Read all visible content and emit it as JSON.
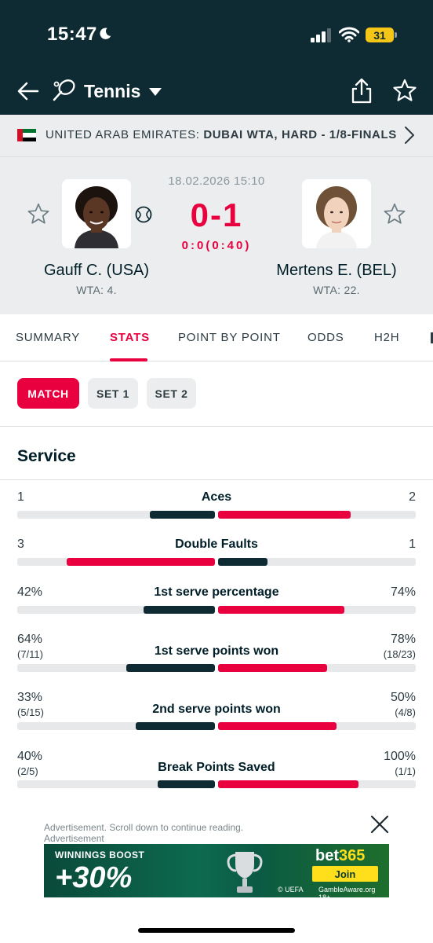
{
  "status_bar": {
    "time": "15:47",
    "battery": "31"
  },
  "header": {
    "sport": "Tennis"
  },
  "breadcrumb": {
    "country": "UNITED ARAB EMIRATES:",
    "tournament": "DUBAI WTA, HARD - 1/8-FINALS"
  },
  "match": {
    "datetime": "18.02.2026 15:10",
    "score": "0-1",
    "game_score": "0:0(0:40)",
    "home": {
      "name": "Gauff C. (USA)",
      "rank": "WTA: 4."
    },
    "away": {
      "name": "Mertens E. (BEL)",
      "rank": "WTA: 22."
    }
  },
  "tabs": [
    {
      "label": "SUMMARY"
    },
    {
      "label": "STATS"
    },
    {
      "label": "POINT BY POINT"
    },
    {
      "label": "ODDS"
    },
    {
      "label": "H2H"
    }
  ],
  "periods": [
    {
      "label": "MATCH"
    },
    {
      "label": "SET 1"
    },
    {
      "label": "SET 2"
    }
  ],
  "section": {
    "title": "Service"
  },
  "stats": [
    {
      "name": "Aces",
      "home": "1",
      "away": "2",
      "home_sub": "",
      "away_sub": "",
      "home_share": 0.33,
      "away_share": 0.67
    },
    {
      "name": "Double Faults",
      "home": "3",
      "away": "1",
      "home_sub": "",
      "away_sub": "",
      "home_share": 0.75,
      "away_share": 0.25
    },
    {
      "name": "1st serve percentage",
      "home": "42%",
      "away": "74%",
      "home_sub": "",
      "away_sub": "",
      "home_share": 0.36,
      "away_share": 0.64
    },
    {
      "name": "1st serve points won",
      "home": "64%",
      "away": "78%",
      "home_sub": "(7/11)",
      "away_sub": "(18/23)",
      "home_share": 0.45,
      "away_share": 0.55
    },
    {
      "name": "2nd serve points won",
      "home": "33%",
      "away": "50%",
      "home_sub": "(5/15)",
      "away_sub": "(4/8)",
      "home_share": 0.4,
      "away_share": 0.6
    },
    {
      "name": "Break Points Saved",
      "home": "40%",
      "away": "100%",
      "home_sub": "(2/5)",
      "away_sub": "(1/1)",
      "home_share": 0.29,
      "away_share": 0.71
    }
  ],
  "ad": {
    "note": "Advertisement. Scroll down to continue reading.",
    "label": "Advertisement",
    "boost": "WINNINGS BOOST",
    "percent": "+30%",
    "brand_a": "bet",
    "brand_b": "365",
    "cta": "Join",
    "uefa": "© UEFA",
    "gamble": "GambleAware.org 18+"
  },
  "colors": {
    "accent": "#e9003f",
    "dark": "#0e2a33",
    "winner_bar": "#e9003f",
    "loser_bar": "#0e2a33"
  }
}
